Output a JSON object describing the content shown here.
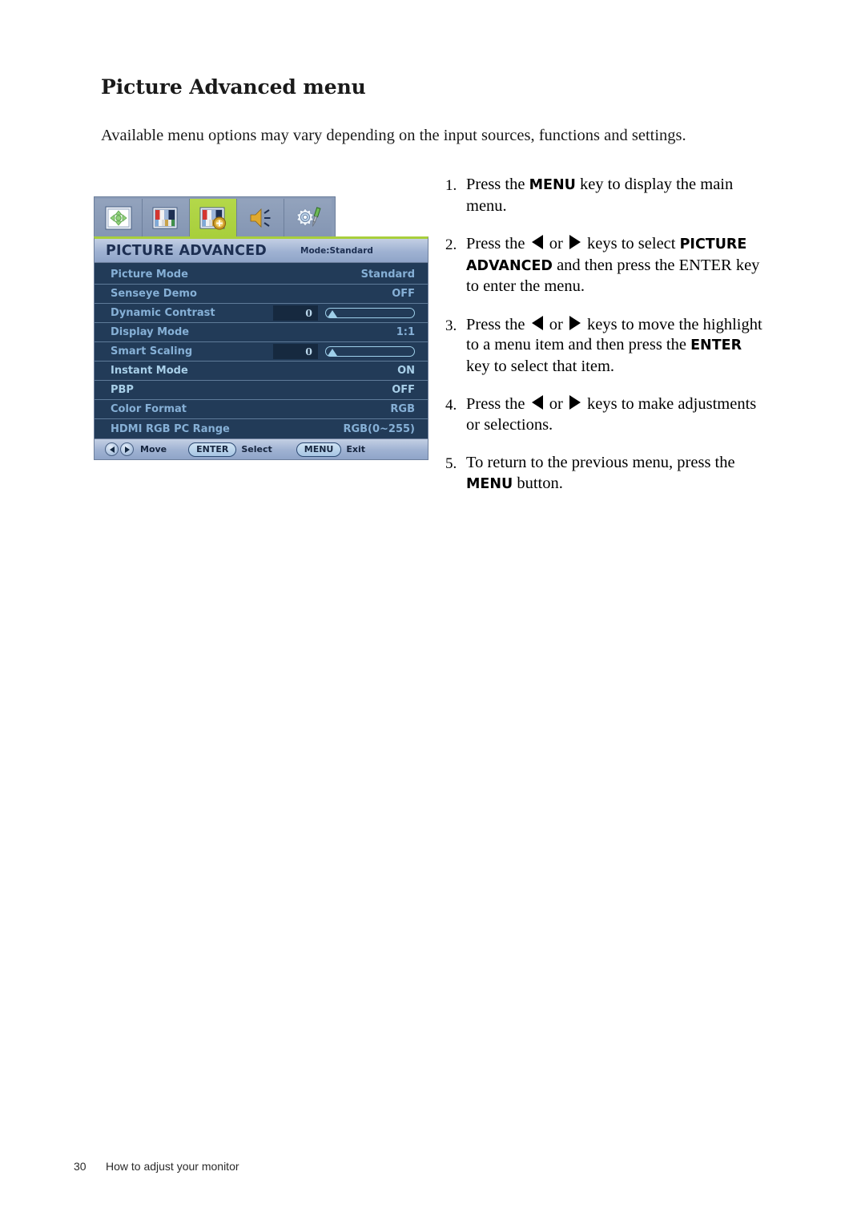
{
  "page": {
    "title": "Picture Advanced menu",
    "intro": "Available menu options may vary depending on the input sources, functions and settings.",
    "footer_page_number": "30",
    "footer_section": "How to adjust your monitor"
  },
  "osd": {
    "tabs": [
      {
        "name": "display-tab",
        "icon": "display-position-icon",
        "active": false
      },
      {
        "name": "picture-tab",
        "icon": "picture-color-bars-icon",
        "active": false
      },
      {
        "name": "picture-advanced-tab",
        "icon": "picture-advanced-plus-icon",
        "active": true
      },
      {
        "name": "audio-tab",
        "icon": "speaker-icon",
        "active": false
      },
      {
        "name": "system-tab",
        "icon": "gear-screwdriver-icon",
        "active": false
      }
    ],
    "title": "PICTURE ADVANCED",
    "mode_label": "Mode:Standard",
    "rows": [
      {
        "label": "Picture Mode",
        "value": "Standard",
        "type": "value",
        "bright": false
      },
      {
        "label": "Senseye Demo",
        "value": "OFF",
        "type": "value",
        "bright": false
      },
      {
        "label": "Dynamic Contrast",
        "value": "0",
        "type": "slider",
        "bright": false
      },
      {
        "label": "Display Mode",
        "value": "1:1",
        "type": "value",
        "bright": false
      },
      {
        "label": "Smart Scaling",
        "value": "0",
        "type": "slider",
        "bright": false
      },
      {
        "label": "Instant Mode",
        "value": "ON",
        "type": "value",
        "bright": true
      },
      {
        "label": "PBP",
        "value": "OFF",
        "type": "value",
        "bright": true
      },
      {
        "label": "Color Format",
        "value": "RGB",
        "type": "value",
        "bright": false
      },
      {
        "label": "HDMI RGB PC Range",
        "value": "RGB(0~255)",
        "type": "value",
        "bright": false
      }
    ],
    "footer": {
      "move_label": "Move",
      "enter_label": "ENTER",
      "select_label": "Select",
      "menu_label": "MENU",
      "exit_label": "Exit"
    },
    "colors": {
      "active_tab": "#a8cf3c",
      "menu_background": "#223b58",
      "menu_text": "#86b0d6",
      "title_text": "#1d2f52",
      "titlebar_gradient_top": "#c3cfe4",
      "titlebar_gradient_bottom": "#8fa4c8"
    }
  },
  "steps": [
    {
      "num": "1.",
      "parts": [
        {
          "t": "text",
          "v": "Press the "
        },
        {
          "t": "bold",
          "v": "MENU"
        },
        {
          "t": "text",
          "v": " key to display the main menu."
        }
      ]
    },
    {
      "num": "2.",
      "parts": [
        {
          "t": "text",
          "v": "Press the "
        },
        {
          "t": "arrow-left",
          "v": "left-arrow-key"
        },
        {
          "t": "text",
          "v": " or "
        },
        {
          "t": "arrow-right",
          "v": "right-arrow-key"
        },
        {
          "t": "text",
          "v": " keys to select "
        },
        {
          "t": "bold",
          "v": "PICTURE ADVANCED"
        },
        {
          "t": "text",
          "v": " and then press the ENTER key to enter the menu."
        }
      ]
    },
    {
      "num": "3.",
      "parts": [
        {
          "t": "text",
          "v": "Press the "
        },
        {
          "t": "arrow-left",
          "v": "left-arrow-key"
        },
        {
          "t": "text",
          "v": " or "
        },
        {
          "t": "arrow-right",
          "v": "right-arrow-key"
        },
        {
          "t": "text",
          "v": " keys to move the highlight to a menu item and then press the "
        },
        {
          "t": "bold",
          "v": "ENTER"
        },
        {
          "t": "text",
          "v": " key to select that item."
        }
      ]
    },
    {
      "num": "4.",
      "parts": [
        {
          "t": "text",
          "v": "Press the "
        },
        {
          "t": "arrow-left",
          "v": "left-arrow-key"
        },
        {
          "t": "text",
          "v": " or "
        },
        {
          "t": "arrow-right",
          "v": "right-arrow-key"
        },
        {
          "t": "text",
          "v": " keys to make adjustments or selections."
        }
      ]
    },
    {
      "num": "5.",
      "parts": [
        {
          "t": "text",
          "v": "To return to the previous menu, press the "
        },
        {
          "t": "bold",
          "v": "MENU"
        },
        {
          "t": "text",
          "v": " button."
        }
      ]
    }
  ]
}
